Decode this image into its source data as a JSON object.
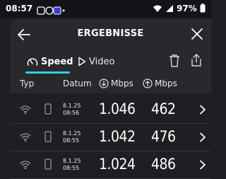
{
  "status_bar": {
    "time": "08:57",
    "battery": "97%"
  },
  "header": {
    "title": "ERGEBNISSE"
  },
  "tabs": [
    {
      "label": "Speed",
      "active": true
    },
    {
      "label": "Video",
      "active": false
    }
  ],
  "columns": {
    "type": "Typ",
    "date": "Datum",
    "download": "Mbps",
    "upload": "Mbps"
  },
  "rows": [
    {
      "date_line1": "8.1.25",
      "date_line2": "08:56",
      "download": "1.046",
      "upload": "462"
    },
    {
      "date_line1": "8.1.25",
      "date_line2": "08:55",
      "download": "1.042",
      "upload": "476"
    },
    {
      "date_line1": "8.1.25",
      "date_line2": "08:55",
      "download": "1.024",
      "upload": "486"
    }
  ],
  "colors": {
    "accent": "#2fd0e0",
    "background": "#1f1f23",
    "panel": "#28282d"
  }
}
